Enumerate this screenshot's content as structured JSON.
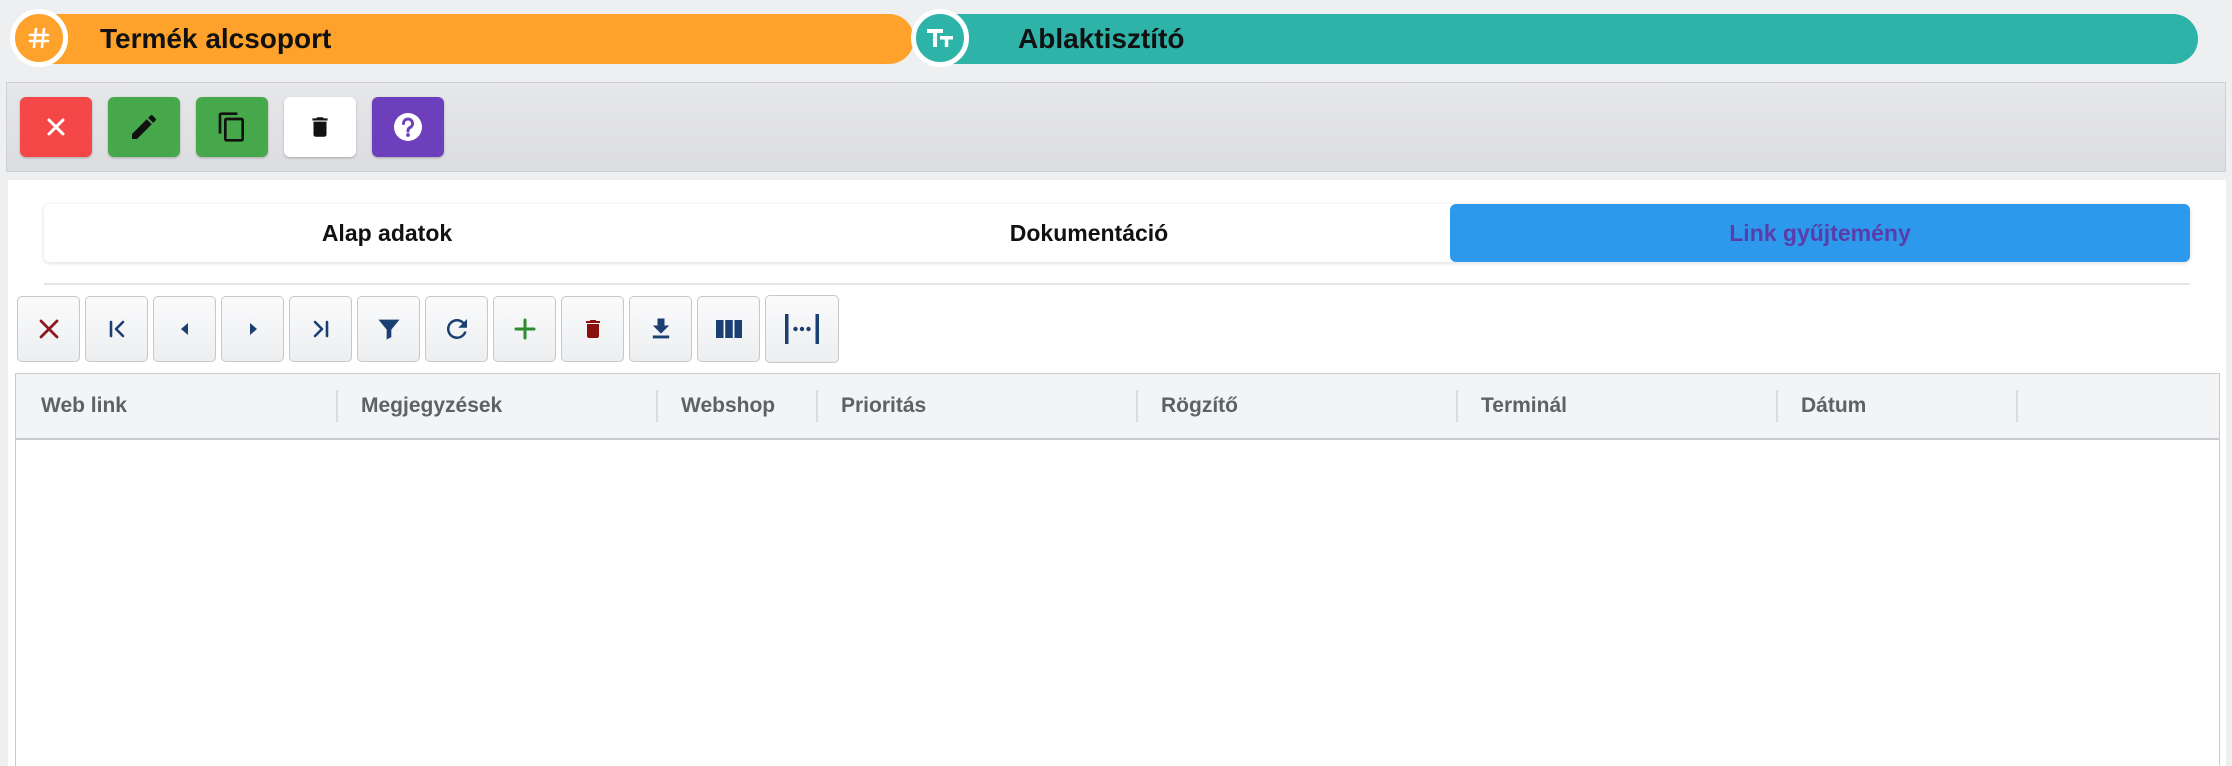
{
  "header": {
    "left_pill": {
      "label": "Termék alcsoport",
      "icon": "hash-icon",
      "color": "#ffa22b"
    },
    "right_pill": {
      "label": "Ablaktisztító",
      "icon": "text-size-icon",
      "color": "#2eb3a9"
    }
  },
  "action_toolbar": {
    "buttons": [
      {
        "name": "close",
        "icon": "close-icon",
        "color": "#f44848"
      },
      {
        "name": "edit",
        "icon": "pencil-icon",
        "color": "#46a84a"
      },
      {
        "name": "copy",
        "icon": "copy-icon",
        "color": "#46a84a"
      },
      {
        "name": "delete",
        "icon": "trash-icon",
        "color": "#ffffff"
      },
      {
        "name": "help",
        "icon": "help-icon",
        "color": "#6d3fbd"
      }
    ]
  },
  "tabs": {
    "items": [
      {
        "label": "Alap adatok",
        "active": false
      },
      {
        "label": "Dokumentáció",
        "active": false
      },
      {
        "label": "Link gyűjtemény",
        "active": true
      }
    ],
    "active_color": "#2d99ed"
  },
  "grid_toolbar": {
    "buttons": [
      {
        "name": "clear",
        "icon": "close-icon"
      },
      {
        "name": "first",
        "icon": "first-page-icon"
      },
      {
        "name": "previous",
        "icon": "caret-left-icon"
      },
      {
        "name": "next",
        "icon": "caret-right-icon"
      },
      {
        "name": "last",
        "icon": "last-page-icon"
      },
      {
        "name": "filter",
        "icon": "filter-icon"
      },
      {
        "name": "refresh",
        "icon": "refresh-icon"
      },
      {
        "name": "add",
        "icon": "plus-icon"
      },
      {
        "name": "delete",
        "icon": "trash-icon"
      },
      {
        "name": "export",
        "icon": "download-icon"
      },
      {
        "name": "columns",
        "icon": "columns-icon"
      },
      {
        "name": "fit-columns",
        "icon": "column-width-icon"
      }
    ]
  },
  "table": {
    "columns": [
      "Web link",
      "Megjegyzések",
      "Webshop",
      "Prioritás",
      "Rögzítő",
      "Terminál",
      "Dátum"
    ],
    "rows": []
  }
}
